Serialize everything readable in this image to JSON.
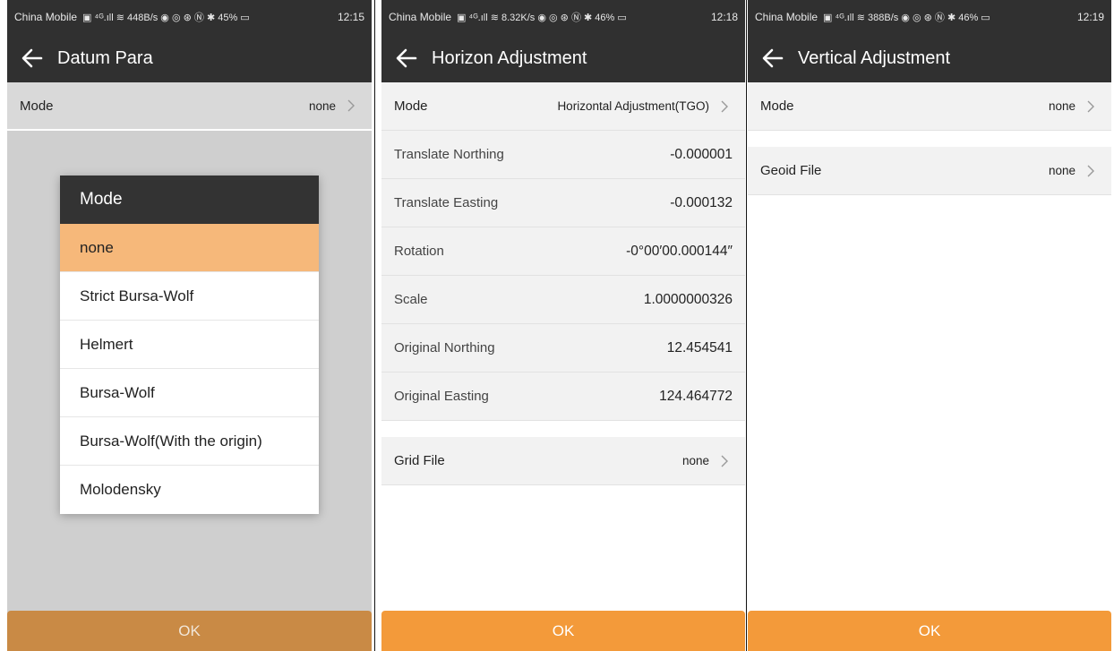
{
  "colors": {
    "bar_dark": "#303030",
    "accent_orange": "#f39a3a",
    "selected_option": "#f6b87a",
    "row_bg": "#f2f2f2"
  },
  "screens": [
    {
      "status": {
        "carrier": "China Mobile",
        "icons": "▣ ⁴ᴳ.ıll ≋ 448B/s ◉ ◎ ⊛ Ⓝ ✱ 45% ▭",
        "time": "12:15"
      },
      "title": "Datum Para",
      "mode": {
        "label": "Mode",
        "value": "none"
      },
      "dialog": {
        "title": "Mode",
        "options": [
          "none",
          "Strict Bursa-Wolf",
          "Helmert",
          "Bursa-Wolf",
          "Bursa-Wolf(With the origin)",
          "Molodensky"
        ],
        "selected": "none"
      },
      "ok": "OK"
    },
    {
      "status": {
        "carrier": "China Mobile",
        "icons": "▣ ⁴ᴳ.ıll ≋ 8.32K/s ◉ ◎ ⊛ Ⓝ ✱ 46% ▭",
        "time": "12:18"
      },
      "title": "Horizon Adjustment",
      "mode": {
        "label": "Mode",
        "value": "Horizontal Adjustment(TGO)"
      },
      "rows": [
        {
          "label": "Translate Northing",
          "value": "-0.000001"
        },
        {
          "label": "Translate Easting",
          "value": "-0.000132"
        },
        {
          "label": "Rotation",
          "value": "-0°00′00.000144″"
        },
        {
          "label": "Scale",
          "value": "1.0000000326"
        },
        {
          "label": "Original Northing",
          "value": "12.454541"
        },
        {
          "label": "Original Easting",
          "value": "124.464772"
        }
      ],
      "grid": {
        "label": "Grid File",
        "value": "none"
      },
      "ok": "OK"
    },
    {
      "status": {
        "carrier": "China Mobile",
        "icons": "▣ ⁴ᴳ.ıll ≋ 388B/s ◉ ◎ ⊛ Ⓝ ✱ 46% ▭",
        "time": "12:19"
      },
      "title": "Vertical Adjustment",
      "mode": {
        "label": "Mode",
        "value": "none"
      },
      "geoid": {
        "label": "Geoid File",
        "value": "none"
      },
      "ok": "OK"
    }
  ]
}
